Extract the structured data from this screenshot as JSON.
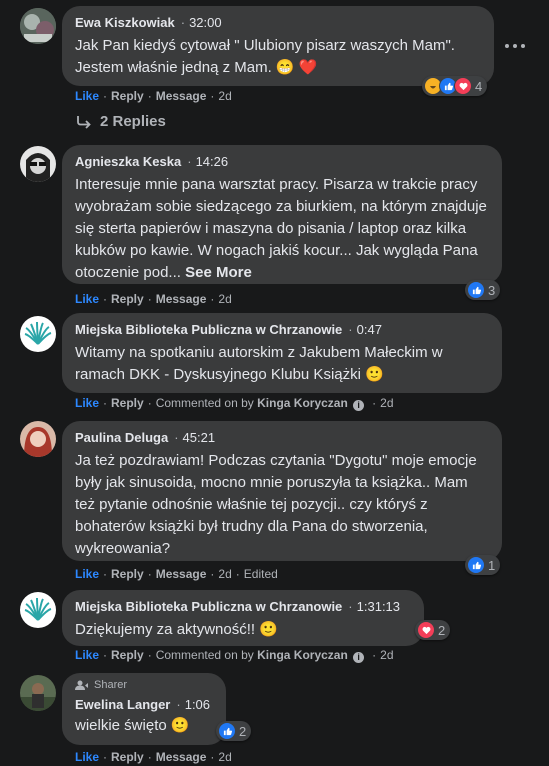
{
  "actions": {
    "like": "Like",
    "reply": "Reply",
    "message": "Message",
    "commented_on_by": "Commented on by",
    "edited": "Edited"
  },
  "comments": [
    {
      "author": "Ewa Kiszkowiak",
      "time": "32:00",
      "text": "Jak Pan kiedyś cytował \" Ulubiony pisarz waszych Mam\". Jestem właśnie jedną z Mam. 😁 ❤️",
      "date": "2d",
      "reaction_count": "4",
      "reaction_icons": [
        "haha-icon",
        "like-icon",
        "love-icon"
      ],
      "replies_label": "2 Replies"
    },
    {
      "author": "Agnieszka Keska",
      "time": "14:26",
      "text": "Interesuje mnie pana warsztat pracy. Pisarza w trakcie pracy wyobrażam sobie siedzącego za biurkiem, na którym znajduje się sterta papierów i maszyna do pisania / laptop oraz kilka kubków po kawie. W nogach jakiś kocur... Jak wygląda Pana otoczenie pod...",
      "see_more": "See More",
      "date": "2d",
      "reaction_count": "3",
      "reaction_icons": [
        "like-icon"
      ]
    },
    {
      "author": "Miejska Biblioteka Publiczna w Chrzanowie",
      "time": "0:47",
      "text": "Witamy na spotkaniu autorskim z Jakubem Małeckim w ramach DKK - Dyskusyjnego Klubu Książki 🙂",
      "commented_by": "Kinga Koryczan",
      "date": "2d"
    },
    {
      "author": "Paulina Deluga",
      "time": "45:21",
      "text": "Ja też pozdrawiam! Podczas czytania \"Dygotu\" moje emocje były jak sinusoida, mocno mnie poruszyła ta książka.. Mam też pytanie odnośnie właśnie tej pozycji.. czy któryś z bohaterów książki był trudny dla Pana do stworzenia, wykreowania?",
      "date": "2d",
      "reaction_count": "1",
      "reaction_icons": [
        "like-icon"
      ]
    },
    {
      "author": "Miejska Biblioteka Publiczna w Chrzanowie",
      "time": "1:31:13",
      "text": "Dziękujemy za aktywność!! 🙂",
      "commented_by": "Kinga Koryczan",
      "date": "2d",
      "reaction_count": "2",
      "reaction_icons": [
        "love-icon"
      ]
    },
    {
      "badge": "Sharer",
      "author": "Ewelina Langer",
      "time": "1:06",
      "text": "wielkie święto 🙂",
      "date": "2d",
      "reaction_count": "2",
      "reaction_icons": [
        "like-icon"
      ]
    }
  ]
}
